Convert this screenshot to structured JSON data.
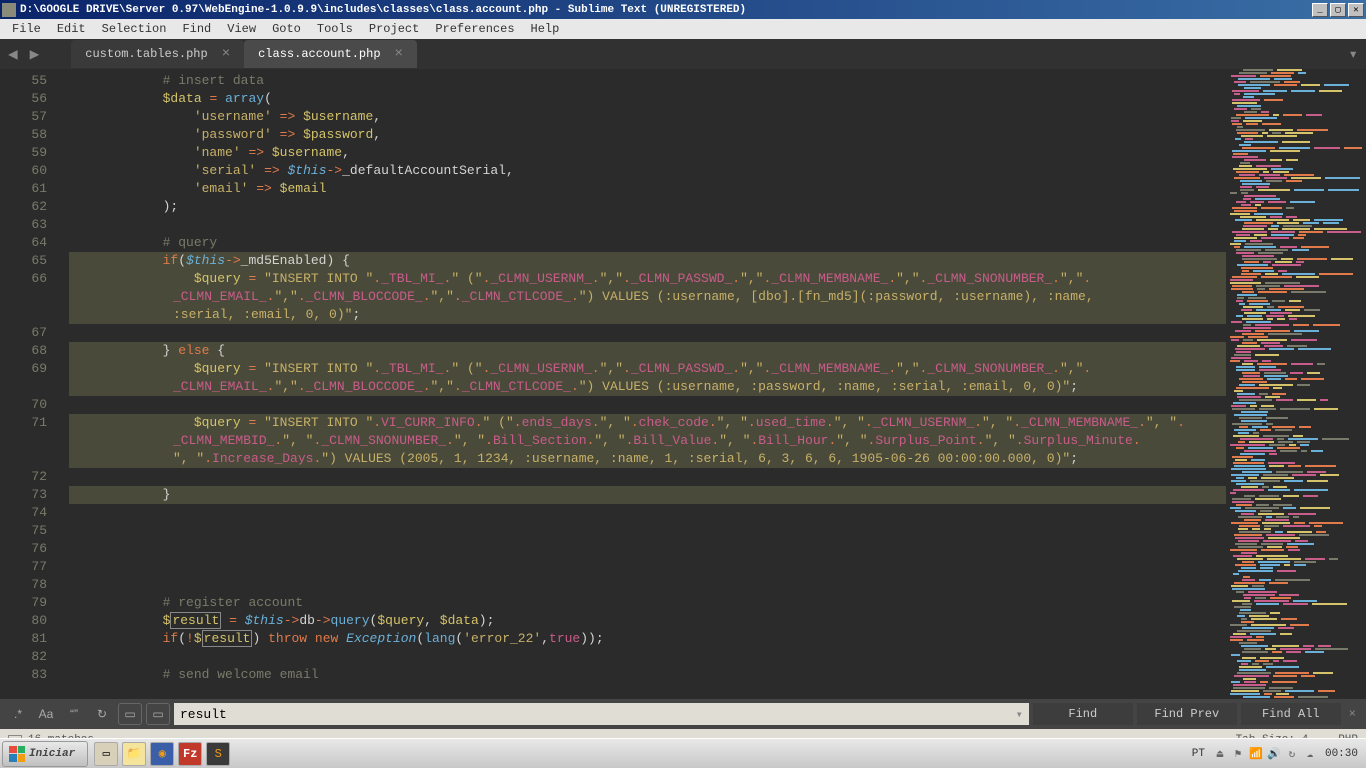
{
  "window": {
    "title": "D:\\GOOGLE DRIVE\\Server 0.97\\WebEngine-1.0.9.9\\includes\\classes\\class.account.php - Sublime Text (UNREGISTERED)",
    "minimize": "_",
    "maximize": "▢",
    "close": "✕"
  },
  "menu": {
    "items": [
      "File",
      "Edit",
      "Selection",
      "Find",
      "View",
      "Goto",
      "Tools",
      "Project",
      "Preferences",
      "Help"
    ]
  },
  "tabs": [
    {
      "label": "custom.tables.php",
      "active": false
    },
    {
      "label": "class.account.php",
      "active": true
    }
  ],
  "line_numbers": [
    55,
    56,
    57,
    58,
    59,
    60,
    61,
    62,
    63,
    64,
    65,
    66,
    67,
    68,
    69,
    70,
    71,
    72,
    73,
    74,
    75,
    76,
    77,
    78,
    79,
    80,
    81,
    82,
    83
  ],
  "code": {
    "l55": "# insert data",
    "l56_var": "$data",
    "l56_func": "array",
    "l57_key": "'username'",
    "l57_val": "$username",
    "l58_key": "'password'",
    "l58_val": "$password",
    "l59_key": "'name'",
    "l59_val": "$username",
    "l60_key": "'serial'",
    "l60_this": "$this",
    "l60_prop": "_defaultAccountSerial",
    "l61_key": "'email'",
    "l61_val": "$email",
    "l64": "# query",
    "l65_this": "$this",
    "l65_prop": "_md5Enabled",
    "l66_var": "$query",
    "l66_insert": "\"INSERT INTO \"",
    "l66_tbl": "_TBL_MI_",
    "l66_p1": "\" (\"",
    "l66_c1": "_CLMN_USERNM_",
    "l66_c2": "_CLMN_PASSWD_",
    "l66_c3": "_CLMN_MEMBNAME_",
    "l66_c4": "_CLMN_SNONUMBER_",
    "l66_c5": "_CLMN_EMAIL_",
    "l66_c6": "_CLMN_BLOCCODE_",
    "l66_c7": "_CLMN_CTLCODE_",
    "l66_vals": "\") VALUES (:username, [dbo].[fn_md5](:password, :username), :name, :serial, :email, 0, 0)\"",
    "l69_var": "$query",
    "l69_insert": "\"INSERT INTO \"",
    "l69_vals": "\") VALUES (:username, :password, :name, :serial, :email, 0, 0)\"",
    "l71_var": "$query",
    "l71_insert": "\"INSERT INTO \"",
    "l71_tbl": "VI_CURR_INFO",
    "l71_c1": "ends_days",
    "l71_c2": "chek_code",
    "l71_c3": "used_time",
    "l71_c4": "_CLMN_USERNM_",
    "l71_c5": "_CLMN_MEMBNAME_",
    "l71_c6": "_CLMN_MEMBID_",
    "l71_c7": "_CLMN_SNONUMBER_",
    "l71_c8": "Bill_Section",
    "l71_c9": "Bill_Value",
    "l71_c10": "Bill_Hour",
    "l71_c11": "Surplus_Point",
    "l71_c12": "Surplus_Minute",
    "l71_c13": "Increase_Days",
    "l71_vals": "\") VALUES (2005, 1, 1234, :username, :name, 1, :serial, 6, 3, 6, 6, 1905-06-26 00:00:00.000, 0)\"",
    "l79": "# register account",
    "l80_var": "$result",
    "l80_this": "$this",
    "l80_q": "$query",
    "l80_d": "$data",
    "l81_result": "$result",
    "l81_lang": "'error_22'",
    "l83": "# send welcome email",
    "kw_if": "if",
    "kw_else": "else",
    "kw_throw": "throw",
    "kw_new": "new",
    "kw_true": "true",
    "fn_lang": "lang",
    "cls_exc": "Exception",
    "arrow": "=>",
    "obj_arrow": "->",
    "sep": "\",\"",
    "sep_sp": "\", \"",
    "open_paren": "\" (\"",
    "concat": "."
  },
  "find": {
    "regex": ".*",
    "case": "Aa",
    "word": "“”",
    "wrap": "↻",
    "sel": "▭",
    "hl": "▭",
    "value": "result",
    "btn_find": "Find",
    "btn_prev": "Find Prev",
    "btn_all": "Find All"
  },
  "status": {
    "matches": "16 matches",
    "tab_size": "Tab Size: 4",
    "lang": "PHP"
  },
  "taskbar": {
    "start": "Iniciar",
    "lang": "PT",
    "clock": "00:30"
  }
}
